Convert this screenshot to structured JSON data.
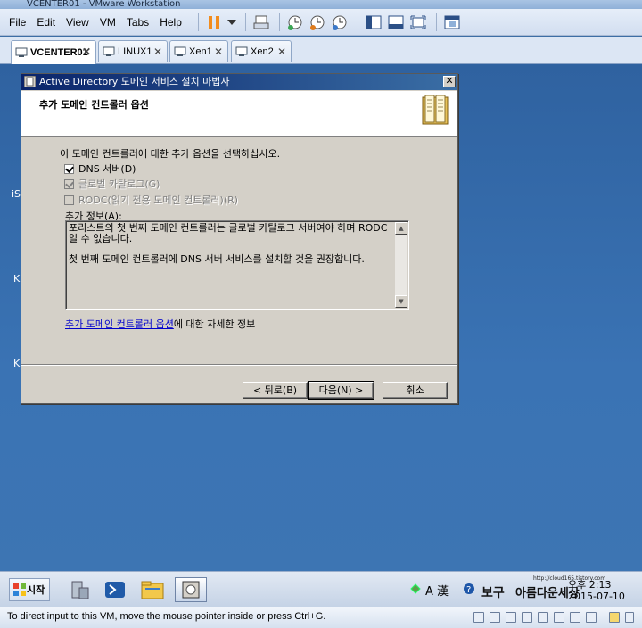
{
  "window": {
    "title": "VCENTER01 - VMware Workstation"
  },
  "menu": {
    "items": [
      "File",
      "Edit",
      "View",
      "VM",
      "Tabs",
      "Help"
    ]
  },
  "toolbar": {
    "icons": [
      "pause-icon",
      "dropdown-icon",
      "send-keys-icon",
      "snapshot-icon",
      "revert-snapshot-icon",
      "snapshot-manager-icon",
      "library-view-icon",
      "console-view-icon",
      "fullscreen-icon",
      "unity-icon"
    ]
  },
  "tabs": [
    {
      "label": "VCENTER01",
      "active": true
    },
    {
      "label": "LINUX1",
      "active": false
    },
    {
      "label": "Xen1",
      "active": false
    },
    {
      "label": "Xen2",
      "active": false
    }
  ],
  "desktop": {
    "fragments": [
      "iS",
      "K",
      "K"
    ]
  },
  "dialog": {
    "title": "Active Directory 도메인 서비스 설치 마법사",
    "close": "✕",
    "header_title": "추가 도메인 컨트롤러 옵션",
    "intro": "이 도메인 컨트롤러에 대한 추가 옵션을 선택하십시오.",
    "options": [
      {
        "label": "DNS 서버(D)",
        "checked": true,
        "disabled": false
      },
      {
        "label": "글로벌 카탈로그(G)",
        "checked": true,
        "disabled": true
      },
      {
        "label": "RODC(읽기 전용 도메인 컨트롤러)(R)",
        "checked": false,
        "disabled": true
      }
    ],
    "info_label": "추가 정보(A):",
    "info_lines": [
      "포리스트의 첫 번째 도메인 컨트롤러는 글로벌 카탈로그 서버여야 하며 RODC일 수 없습니다.",
      "첫 번째 도메인 컨트롤러에 DNS 서버 서비스를 설치할 것을 권장합니다."
    ],
    "more_link": "추가 도메인 컨트롤러 옵션",
    "more_suffix": "에 대한 자세한 정보",
    "buttons": {
      "back": "< 뒤로(B)",
      "next": "다음(N) >",
      "cancel": "취소"
    }
  },
  "taskbar": {
    "start_label": "시작",
    "tray_text": "A 漢",
    "time": "오후 2:13",
    "date": "2015-07-10"
  },
  "watermark": {
    "url": "http://cloud165.tistory.com",
    "text": "보구 이름다운세상"
  },
  "status": {
    "text": "To direct input to this VM, move the mouse pointer inside or press Ctrl+G."
  },
  "colors": {
    "accent": "#0a246a",
    "desktop": "#3a73b4",
    "link": "#0000cc"
  }
}
